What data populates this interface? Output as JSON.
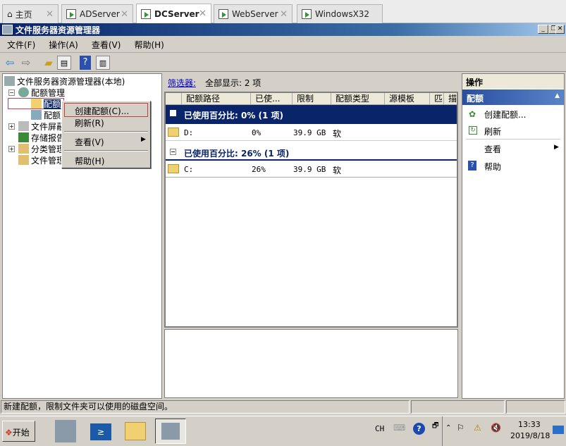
{
  "tabs": [
    {
      "label": "主页"
    },
    {
      "label": "ADServer"
    },
    {
      "label": "DCServer",
      "active": true
    },
    {
      "label": "WebServer"
    },
    {
      "label": "WindowsX32"
    }
  ],
  "window": {
    "title": "文件服务器资源管理器"
  },
  "menu": [
    "文件(F)",
    "操作(A)",
    "查看(V)",
    "帮助(H)"
  ],
  "tree": {
    "root": "文件服务器资源管理器(本地)",
    "items": [
      "配额管理",
      "配额",
      "配额",
      "文件屏蔽",
      "存储报告",
      "分类管理",
      "文件管理"
    ]
  },
  "context_menu": [
    "创建配额(C)...",
    "刷新(R)",
    "查看(V)",
    "帮助(H)"
  ],
  "filter": {
    "link": "筛选器:",
    "text": "全部显示: 2 项"
  },
  "columns": [
    "配额路径",
    "已使...",
    "限制",
    "配额类型",
    "源模板",
    "匹",
    "描"
  ],
  "groups": [
    {
      "label": "已使用百分比: 0% (1 项)",
      "rows": [
        {
          "path": "D:",
          "used": "0%",
          "limit": "39.9 GB",
          "type": "软"
        }
      ]
    },
    {
      "label": "已使用百分比: 26% (1 项)",
      "rows": [
        {
          "path": "C:",
          "used": "26%",
          "limit": "39.9 GB",
          "type": "软"
        }
      ]
    }
  ],
  "actions": {
    "header": "操作",
    "section": "配额",
    "items": [
      "创建配额...",
      "刷新",
      "查看",
      "帮助"
    ]
  },
  "status": "新建配额，限制文件夹可以使用的磁盘空间。",
  "taskbar": {
    "start": "开始",
    "lang": "CH",
    "time": "13:33",
    "date": "2019/8/18"
  },
  "colors": {
    "titlebar": "#0a246a",
    "group_selected": "#0a246a",
    "link": "#0000cc"
  }
}
